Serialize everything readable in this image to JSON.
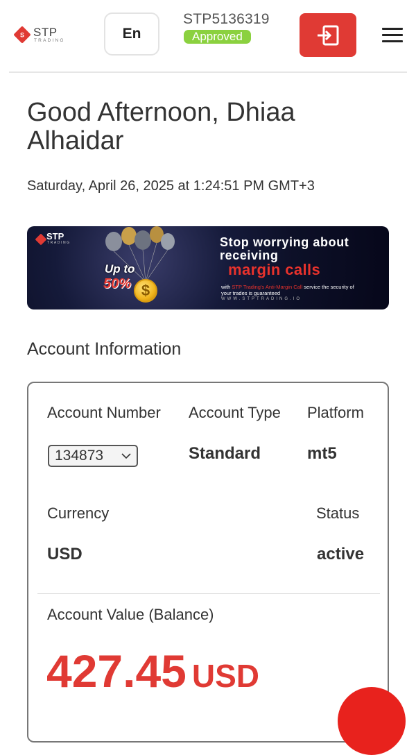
{
  "header": {
    "logo_text": "STP",
    "logo_sub": "TRADING",
    "language_label": "En",
    "account_id": "STP5136319",
    "status_badge": "Approved",
    "logout_icon": "logout-icon",
    "menu_icon": "hamburger-menu-icon",
    "accent_color": "#e03a34",
    "badge_color": "#8bd13f"
  },
  "greeting": {
    "text": "Good Afternoon, Dhiaa Alhaidar",
    "datetime": "Saturday, April 26, 2025 at 1:24:51 PM GMT+3"
  },
  "banner": {
    "logo_text": "STP",
    "logo_sub": "TRADING",
    "up_to": "Up to",
    "percent": "50%",
    "headline": "Stop worrying about receiving",
    "highlight": "margin calls",
    "small_prefix": "with ",
    "small_highlight": "STP Trading's Anti-Margin Call",
    "small_suffix": " service the security of your trades is guaranteed",
    "url": "WWW.STPTRADING.IO"
  },
  "account": {
    "section_title": "Account Information",
    "labels": {
      "account_number": "Account Number",
      "account_type": "Account Type",
      "platform": "Platform",
      "currency": "Currency",
      "status": "Status",
      "balance": "Account Value (Balance)"
    },
    "values": {
      "account_number": "134873",
      "account_type": "Standard",
      "platform": "mt5",
      "currency": "USD",
      "status": "active",
      "balance_amount": "427.45",
      "balance_currency": "USD"
    }
  }
}
